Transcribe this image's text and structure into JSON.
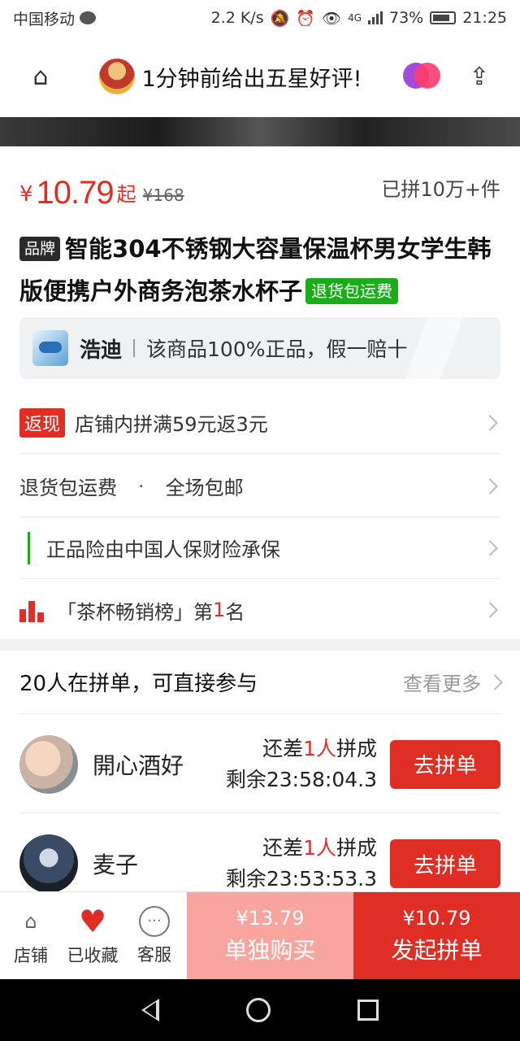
{
  "status_bar": {
    "carrier": "中国移动",
    "speed": "2.2 K/s",
    "network": "4G",
    "battery": "73%",
    "time": "21:25"
  },
  "top_nav": {
    "notice": "1分钟前给出五星好评!",
    "left_icon": "home-icon",
    "right_icon": "share-icon"
  },
  "price": {
    "currency": "¥",
    "current": "10.79",
    "suffix": "起",
    "original": "¥168",
    "sold": "已拼10万+件"
  },
  "product": {
    "brand_tag": "品牌",
    "title": "智能304不锈钢大容量保温杯男女学生韩版便携户外商务泡茶水杯子",
    "return_tag": "退货包运费"
  },
  "store": {
    "name": "浩迪",
    "guarantee": "该商品100%正品，假一赔十"
  },
  "info_rows": {
    "rebate_tag": "返现",
    "rebate_text": "店铺内拼满59元返3元",
    "return_shipping": "退货包运费",
    "free_shipping": "全场包邮",
    "dot": "·",
    "insurance": "正品险由中国人保财险承保",
    "rank_prefix": "「茶杯畅销榜」第",
    "rank_num": "1",
    "rank_suffix": "名"
  },
  "group_section": {
    "title": "20人在拼单，可直接参与",
    "more": "查看更多"
  },
  "groups": [
    {
      "name": "開心酒好",
      "need_prefix": "还差",
      "need_num": "1人",
      "need_suffix": "拼成",
      "remain_label": "剩余",
      "remain": "23:58:04.3",
      "button": "去拼单"
    },
    {
      "name": "麦子",
      "need_prefix": "还差",
      "need_num": "1人",
      "need_suffix": "拼成",
      "remain_label": "剩余",
      "remain": "23:53:53.3",
      "button": "去拼单"
    }
  ],
  "action_bar": {
    "store": "店铺",
    "favorite": "已收藏",
    "service": "客服",
    "single_price": "¥13.79",
    "single_label": "单独购买",
    "group_price": "¥10.79",
    "group_label": "发起拼单"
  },
  "colors": {
    "accent": "#e02e24",
    "green": "#1aad19",
    "single_buy_bg": "#f8a5a0"
  }
}
